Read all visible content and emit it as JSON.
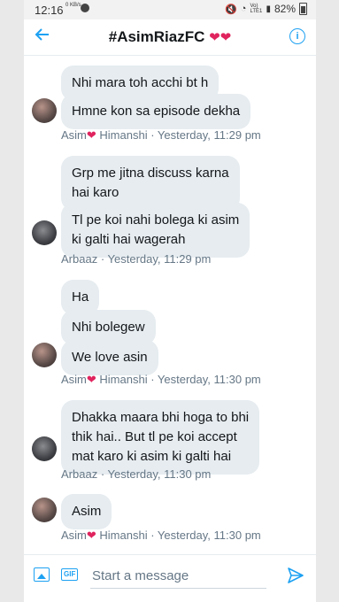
{
  "status": {
    "time": "12:16",
    "data_speed": "0 KB/s",
    "network": "Vo) LTE1",
    "battery": "82%"
  },
  "header": {
    "title": "#AsimRiazFC",
    "title_hearts": "❤❤"
  },
  "messages": [
    {
      "text": "Nhi mara toh acchi bt h"
    },
    {
      "text": "Hmne kon sa episode dekha"
    },
    {
      "text": "Grp me jitna discuss karna\nhai karo"
    },
    {
      "text": "Tl pe koi nahi bolega ki asim\nki galti hai wagerah"
    },
    {
      "text": "Ha"
    },
    {
      "text": "Nhi bolegew"
    },
    {
      "text": "We love asin"
    },
    {
      "text": "Dhakka maara bhi hoga to bhi\nthik hai.. But tl pe koi accept\nmat karo ki asim ki galti hai"
    },
    {
      "text": "Asim"
    }
  ],
  "meta": [
    {
      "name_a": "Asim",
      "heart": "❤",
      "name_b": " Himanshi",
      "time": " · Yesterday, 11:29 pm"
    },
    {
      "name_a": "Arbaaz",
      "heart": "",
      "name_b": "",
      "time": " · Yesterday, 11:29 pm"
    },
    {
      "name_a": "Asim",
      "heart": "❤",
      "name_b": " Himanshi",
      "time": " · Yesterday, 11:30 pm"
    },
    {
      "name_a": "Arbaaz",
      "heart": "",
      "name_b": "",
      "time": " · Yesterday, 11:30 pm"
    },
    {
      "name_a": "Asim",
      "heart": "❤",
      "name_b": " Himanshi",
      "time": " · Yesterday, 11:30 pm"
    }
  ],
  "compose": {
    "placeholder": "Start a message",
    "value": "",
    "gif_label": "GIF"
  },
  "colors": {
    "accent": "#1da1f2",
    "bubble": "#e6ecf0",
    "heart": "#e0245e",
    "meta_text": "#657786"
  }
}
